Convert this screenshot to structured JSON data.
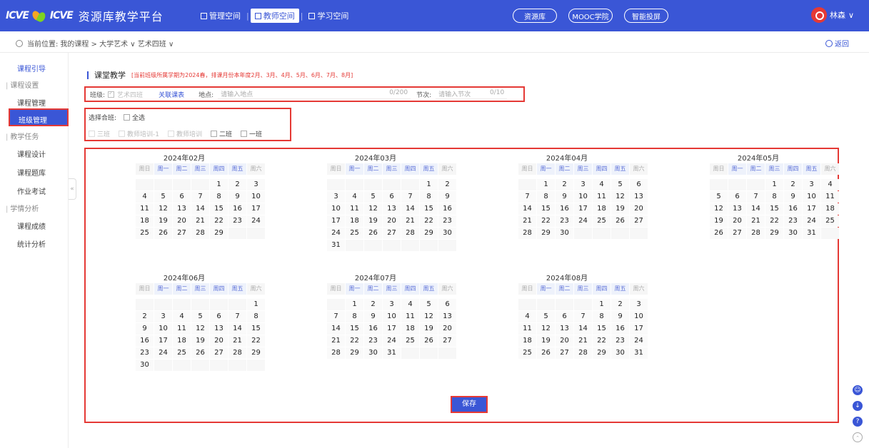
{
  "topbar": {
    "logo_text": "ICVE",
    "logo_text2": "ICVE",
    "title": "资源库教学平台",
    "nav": [
      {
        "label": "管理空间",
        "active": false
      },
      {
        "label": "教师空间",
        "active": true
      },
      {
        "label": "学习空间",
        "active": false
      }
    ],
    "pills": [
      "资源库",
      "MOOC学院",
      "智能投屏"
    ],
    "user_name": "林森"
  },
  "breadcrumb": {
    "prefix": "当前位置:",
    "path": "我的课程 > 大学艺术 ∨  艺术四班 ∨",
    "back": "返回"
  },
  "sidebar": {
    "head": "课程引导",
    "groups": [
      {
        "label": "课程设置",
        "items": [
          "课程管理",
          "班级管理"
        ]
      },
      {
        "label": "教学任务",
        "items": [
          "课程设计",
          "课程题库",
          "作业考试"
        ]
      },
      {
        "label": "学情分析",
        "items": [
          "课程成绩",
          "统计分析"
        ]
      }
    ],
    "active": "班级管理"
  },
  "section": {
    "title": "课堂教学",
    "note": "[当前班级所属学期为2024春，排课月份本年度2月、3月、4月、5月、6月、7月、8月]"
  },
  "form": {
    "class_label": "班级:",
    "class_value": "艺术四班",
    "link_label": "关联课表",
    "place_label": "地点:",
    "place_placeholder": "请输入地点",
    "place_count": "0/200",
    "session_label": "节次:",
    "session_placeholder": "请输入节次",
    "session_count": "0/10"
  },
  "merge": {
    "label": "选择合班:",
    "select_all": "全选",
    "options": [
      {
        "label": "三班",
        "disabled": true
      },
      {
        "label": "教师培训-1",
        "disabled": true
      },
      {
        "label": "教师培训",
        "disabled": true
      },
      {
        "label": "二班",
        "disabled": false
      },
      {
        "label": "一班",
        "disabled": false
      }
    ]
  },
  "weekdays": [
    "周日",
    "周一",
    "周二",
    "周三",
    "周四",
    "周五",
    "周六"
  ],
  "months": [
    {
      "title": "2024年02月",
      "offset": 4,
      "days": 29
    },
    {
      "title": "2024年03月",
      "offset": 5,
      "days": 31
    },
    {
      "title": "2024年04月",
      "offset": 1,
      "days": 30
    },
    {
      "title": "2024年05月",
      "offset": 3,
      "days": 31
    },
    {
      "title": "2024年06月",
      "offset": 6,
      "days": 30
    },
    {
      "title": "2024年07月",
      "offset": 1,
      "days": 31
    },
    {
      "title": "2024年08月",
      "offset": 4,
      "days": 31
    }
  ],
  "save_label": "保存",
  "colors": {
    "primary": "#3a56d6",
    "highlight": "#e53935"
  }
}
